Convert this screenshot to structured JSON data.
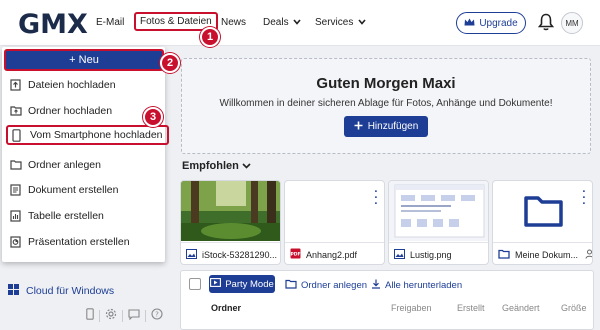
{
  "header": {
    "logo": "GMX",
    "nav": [
      {
        "label": "E-Mail"
      },
      {
        "label": "Fotos & Dateien"
      },
      {
        "label": "News"
      },
      {
        "label": "Deals"
      },
      {
        "label": "Services"
      }
    ],
    "upgrade_label": "Upgrade",
    "avatar_initials": "MM"
  },
  "steps": [
    "1",
    "2",
    "3"
  ],
  "sidebar": {
    "new_button": "+ Neu",
    "menu": [
      {
        "label": "Dateien hochladen",
        "icon": "file-upload-icon"
      },
      {
        "label": "Ordner hochladen",
        "icon": "folder-upload-icon"
      },
      {
        "label": "Vom Smartphone hochladen",
        "icon": "smartphone-icon"
      },
      {
        "label": "Ordner anlegen",
        "icon": "folder-add-icon"
      },
      {
        "label": "Dokument erstellen",
        "icon": "document-icon"
      },
      {
        "label": "Tabelle erstellen",
        "icon": "spreadsheet-icon"
      },
      {
        "label": "Präsentation erstellen",
        "icon": "presentation-icon"
      }
    ],
    "cloud_label": "Cloud für Windows"
  },
  "hero": {
    "title": "Guten Morgen Maxi",
    "subtitle": "Willkommen in deiner sicheren Ablage für Fotos, Anhänge und Dokumente!",
    "add_label": "Hinzufügen"
  },
  "recommended": {
    "label": "Empfohlen",
    "cards": [
      {
        "name": "iStock-53281290...",
        "type": "image"
      },
      {
        "name": "Anhang2.pdf",
        "type": "pdf"
      },
      {
        "name": "Lustig.png",
        "type": "image"
      },
      {
        "name": "Meine Dokum...",
        "type": "folder"
      }
    ]
  },
  "list": {
    "party_mode": "Party Mode",
    "create_folder": "Ordner anlegen",
    "download_all": "Alle herunterladen",
    "columns": [
      "Ordner",
      "Freigaben",
      "Erstellt",
      "Geändert",
      "Größe"
    ]
  },
  "colors": {
    "brand_blue": "#1e3e96",
    "highlight_red": "#c8102e"
  }
}
